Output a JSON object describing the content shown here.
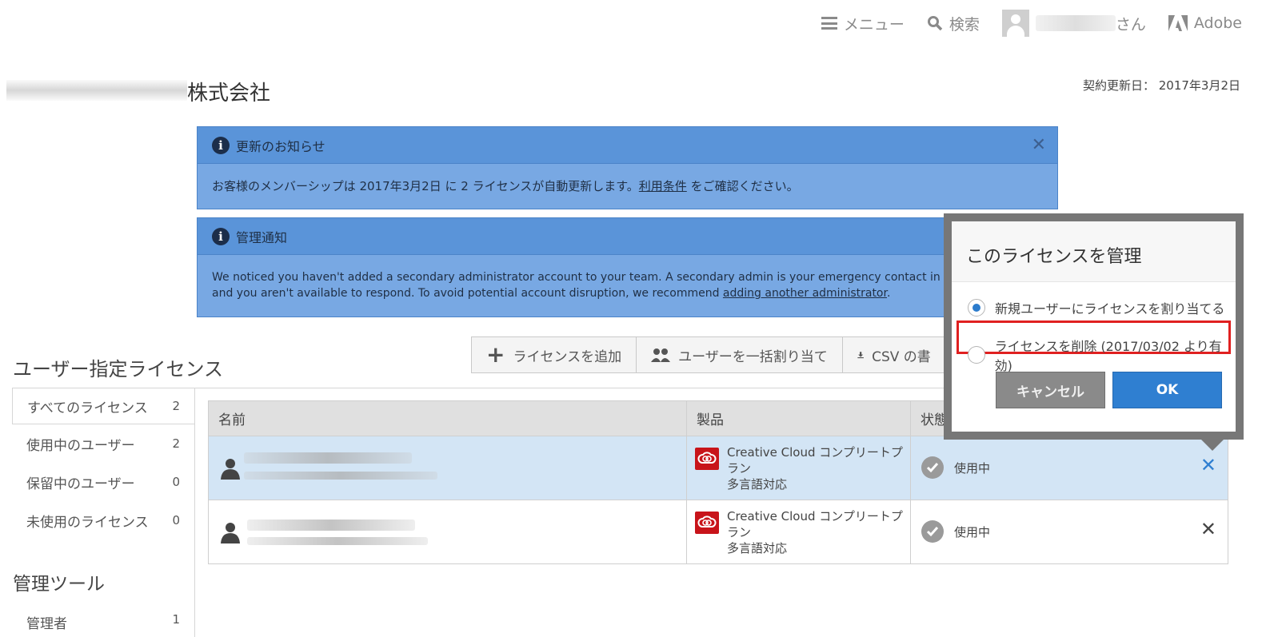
{
  "topnav": {
    "menu_label": "メニュー",
    "search_label": "検索",
    "user_suffix": "さん",
    "brand": "Adobe"
  },
  "header": {
    "company_suffix": "株式会社",
    "renewal_label": "契約更新日：",
    "renewal_date": "2017年3月2日"
  },
  "notices": [
    {
      "title": "更新のお知らせ",
      "body_before": "お客様のメンバーシップは 2017年3月2日 に 2 ライセンスが自動更新します。",
      "link": "利用条件",
      "body_after": " をご確認ください。"
    },
    {
      "title": "管理通知",
      "line1": "We noticed you haven't added a secondary administrator account to your team. A secondary admin is your emergency contact in case any bi",
      "line2_before": "and you aren't available to respond. To avoid potential account disruption, we recommend ",
      "link": "adding another administrator",
      "line2_after": "."
    }
  ],
  "section": {
    "title": "ユーザー指定ライセンス",
    "toolbar": {
      "add_license": "ライセンスを追加",
      "bulk_assign": "ユーザーを一括割り当て",
      "csv": "CSV の書"
    }
  },
  "sidebar": {
    "items": [
      {
        "label": "すべてのライセンス",
        "count": "2"
      },
      {
        "label": "使用中のユーザー",
        "count": "2"
      },
      {
        "label": "保留中のユーザー",
        "count": "0"
      },
      {
        "label": "未使用のライセンス",
        "count": "0"
      }
    ],
    "tools_title": "管理ツール",
    "admin_label": "管理者",
    "admin_count": "1"
  },
  "table": {
    "headers": [
      "名前",
      "製品",
      "状態"
    ],
    "rows": [
      {
        "product_line1": "Creative Cloud コンプリートプ",
        "product_line2": "ラン",
        "product_line3": "多言語対応",
        "status": "使用中"
      },
      {
        "product_line1": "Creative Cloud コンプリートプ",
        "product_line2": "ラン",
        "product_line3": "多言語対応",
        "status": "使用中"
      }
    ]
  },
  "popover": {
    "title": "このライセンスを管理",
    "option1": "新規ユーザーにライセンスを割り当てる",
    "option2": "ライセンスを削除 (2017/03/02 より有効)",
    "cancel": "キャンセル",
    "ok": "OK"
  },
  "colors": {
    "notice_bg": "#78a8e3",
    "notice_head": "#5a94d9",
    "accent_blue": "#2f7fd1",
    "highlight_red": "#e02020",
    "selected_row": "#d3e5f5"
  }
}
